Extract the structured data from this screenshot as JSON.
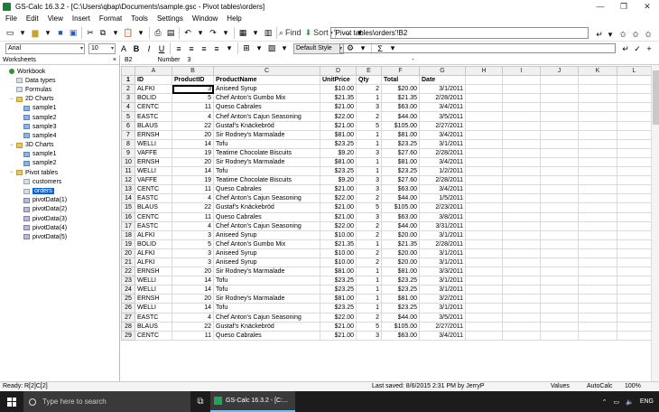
{
  "window": {
    "title": "GS-Calc 16.3.2 - [C:\\Users\\qbap\\Documents\\sample.gsc - Pivot tables\\orders]",
    "controls": [
      "minimize",
      "restore",
      "close"
    ]
  },
  "menu": [
    "File",
    "Edit",
    "View",
    "Insert",
    "Format",
    "Tools",
    "Settings",
    "Window",
    "Help"
  ],
  "toolbar": {
    "find_label": "Find",
    "sort_label": "Sort",
    "cell_address": "'Pivot tables\\orders'!B2"
  },
  "format_bar": {
    "font_name": "Arial",
    "font_size": "10",
    "style_name": "Default Style",
    "sum_symbol": "Σ"
  },
  "worksheets_panel": {
    "title": "Worksheets",
    "close_glyph": "×",
    "tree": [
      {
        "label": "Workbook",
        "kind": "book",
        "level": 0,
        "exp": ""
      },
      {
        "label": "Data types",
        "kind": "sheet",
        "level": 1,
        "exp": ""
      },
      {
        "label": "Formulas",
        "kind": "sheet",
        "level": 1,
        "exp": ""
      },
      {
        "label": "2D Charts",
        "kind": "folder",
        "level": 1,
        "exp": "−"
      },
      {
        "label": "sample1",
        "kind": "chart",
        "level": 2,
        "exp": ""
      },
      {
        "label": "sample2",
        "kind": "chart",
        "level": 2,
        "exp": ""
      },
      {
        "label": "sample3",
        "kind": "chart",
        "level": 2,
        "exp": ""
      },
      {
        "label": "sample4",
        "kind": "chart",
        "level": 2,
        "exp": ""
      },
      {
        "label": "3D Charts",
        "kind": "folder",
        "level": 1,
        "exp": "−"
      },
      {
        "label": "sample1",
        "kind": "chart",
        "level": 2,
        "exp": ""
      },
      {
        "label": "sample2",
        "kind": "chart",
        "level": 2,
        "exp": ""
      },
      {
        "label": "Pivot tables",
        "kind": "folder",
        "level": 1,
        "exp": "−"
      },
      {
        "label": "customers",
        "kind": "sheet",
        "level": 2,
        "exp": ""
      },
      {
        "label": "orders",
        "kind": "sheet",
        "level": 2,
        "exp": "",
        "selected": true
      },
      {
        "label": "pivotData(1)",
        "kind": "pivot",
        "level": 2,
        "exp": ""
      },
      {
        "label": "pivotData(2)",
        "kind": "pivot",
        "level": 2,
        "exp": ""
      },
      {
        "label": "pivotData(3)",
        "kind": "pivot",
        "level": 2,
        "exp": ""
      },
      {
        "label": "pivotData(4)",
        "kind": "pivot",
        "level": 2,
        "exp": ""
      },
      {
        "label": "pivotData(5)",
        "kind": "pivot",
        "level": 2,
        "exp": ""
      }
    ]
  },
  "cell_bar": {
    "ref": "B2",
    "type": "Number",
    "value": "3",
    "extra": "-"
  },
  "sheet": {
    "columns": [
      "A",
      "B",
      "C",
      "D",
      "E",
      "F",
      "G",
      "H",
      "I",
      "J",
      "K",
      "L"
    ],
    "rows": [
      [
        "1",
        "ID",
        "ProductID",
        "ProductName",
        "UnitPrice",
        "Qty",
        "Total",
        "Date"
      ],
      [
        "2",
        "ALFKI",
        "3",
        "Aniseed Syrup",
        "$10.00",
        "2",
        "$20.00",
        "3/1/2011"
      ],
      [
        "3",
        "BOLID",
        "5",
        "Chef Anton's Gumbo Mix",
        "$21.35",
        "1",
        "$21.35",
        "2/28/2011"
      ],
      [
        "4",
        "CENTC",
        "11",
        "Queso Cabrales",
        "$21.00",
        "3",
        "$63.00",
        "3/4/2011"
      ],
      [
        "5",
        "EASTC",
        "4",
        "Chef Anton's Cajun Seasoning",
        "$22.00",
        "2",
        "$44.00",
        "3/5/2011"
      ],
      [
        "6",
        "BLAUS",
        "22",
        "Gustaf's Knäckebröd",
        "$21.00",
        "5",
        "$105.00",
        "2/27/2011"
      ],
      [
        "7",
        "ERNSH",
        "20",
        "Sir Rodney's Marmalade",
        "$81.00",
        "1",
        "$81.00",
        "3/4/2011"
      ],
      [
        "8",
        "WELLI",
        "14",
        "Tofu",
        "$23.25",
        "1",
        "$23.25",
        "3/1/2011"
      ],
      [
        "9",
        "VAFFE",
        "19",
        "Teatime Chocolate Biscuits",
        "$9.20",
        "3",
        "$27.60",
        "2/28/2011"
      ],
      [
        "10",
        "ERNSH",
        "20",
        "Sir Rodney's Marmalade",
        "$81.00",
        "1",
        "$81.00",
        "3/4/2011"
      ],
      [
        "11",
        "WELLI",
        "14",
        "Tofu",
        "$23.25",
        "1",
        "$23.25",
        "1/2/2011"
      ],
      [
        "12",
        "VAFFE",
        "19",
        "Teatime Chocolate Biscuits",
        "$9.20",
        "3",
        "$27.60",
        "2/28/2011"
      ],
      [
        "13",
        "CENTC",
        "11",
        "Queso Cabrales",
        "$21.00",
        "3",
        "$63.00",
        "3/4/2011"
      ],
      [
        "14",
        "EASTC",
        "4",
        "Chef Anton's Cajun Seasoning",
        "$22.00",
        "2",
        "$44.00",
        "1/5/2011"
      ],
      [
        "15",
        "BLAUS",
        "22",
        "Gustaf's Knäckebröd",
        "$21.00",
        "5",
        "$105.00",
        "2/23/2011"
      ],
      [
        "16",
        "CENTC",
        "11",
        "Queso Cabrales",
        "$21.00",
        "3",
        "$63.00",
        "3/8/2011"
      ],
      [
        "17",
        "EASTC",
        "4",
        "Chef Anton's Cajun Seasoning",
        "$22.00",
        "2",
        "$44.00",
        "3/31/2011"
      ],
      [
        "18",
        "ALFKI",
        "3",
        "Aniseed Syrup",
        "$10.00",
        "2",
        "$20.00",
        "3/1/2011"
      ],
      [
        "19",
        "BOLID",
        "5",
        "Chef Anton's Gumbo Mix",
        "$21.35",
        "1",
        "$21.35",
        "2/28/2011"
      ],
      [
        "20",
        "ALFKI",
        "3",
        "Aniseed Syrup",
        "$10.00",
        "2",
        "$20.00",
        "3/1/2011"
      ],
      [
        "21",
        "ALFKI",
        "3",
        "Aniseed Syrup",
        "$10.00",
        "2",
        "$20.00",
        "3/1/2011"
      ],
      [
        "22",
        "ERNSH",
        "20",
        "Sir Rodney's Marmalade",
        "$81.00",
        "1",
        "$81.00",
        "3/3/2011"
      ],
      [
        "23",
        "WELLI",
        "14",
        "Tofu",
        "$23.25",
        "1",
        "$23.25",
        "3/1/2011"
      ],
      [
        "24",
        "WELLI",
        "14",
        "Tofu",
        "$23.25",
        "1",
        "$23.25",
        "3/1/2011"
      ],
      [
        "25",
        "ERNSH",
        "20",
        "Sir Rodney's Marmalade",
        "$81.00",
        "1",
        "$81.00",
        "3/2/2011"
      ],
      [
        "26",
        "WELLI",
        "14",
        "Tofu",
        "$23.25",
        "1",
        "$23.25",
        "3/1/2011"
      ],
      [
        "27",
        "EASTC",
        "4",
        "Chef Anton's Cajun Seasoning",
        "$22.00",
        "2",
        "$44.00",
        "3/5/2011"
      ],
      [
        "28",
        "BLAUS",
        "22",
        "Gustaf's Knäckebröd",
        "$21.00",
        "5",
        "$105.00",
        "2/27/2011"
      ],
      [
        "29",
        "CENTC",
        "11",
        "Queso Cabrales",
        "$21.00",
        "3",
        "$63.00",
        "3/4/2011"
      ]
    ],
    "active_cell": "B2"
  },
  "status": {
    "ready": "Ready:",
    "cell": "R[2]C[2]",
    "last_saved": "Last saved:  8/6/2015 2:31 PM  by  JerryP",
    "values": "Values",
    "autocalc": "AutoCalc",
    "zoom": "100%"
  },
  "taskbar": {
    "search_placeholder": "Type here to search",
    "app_label": "GS-Calc 16.3.2 - [C:...",
    "lang": "ENG"
  },
  "colors": {
    "selection": "#0a64d6",
    "taskbar": "#1c1c1c",
    "app_icon": "#1e7b3d"
  }
}
